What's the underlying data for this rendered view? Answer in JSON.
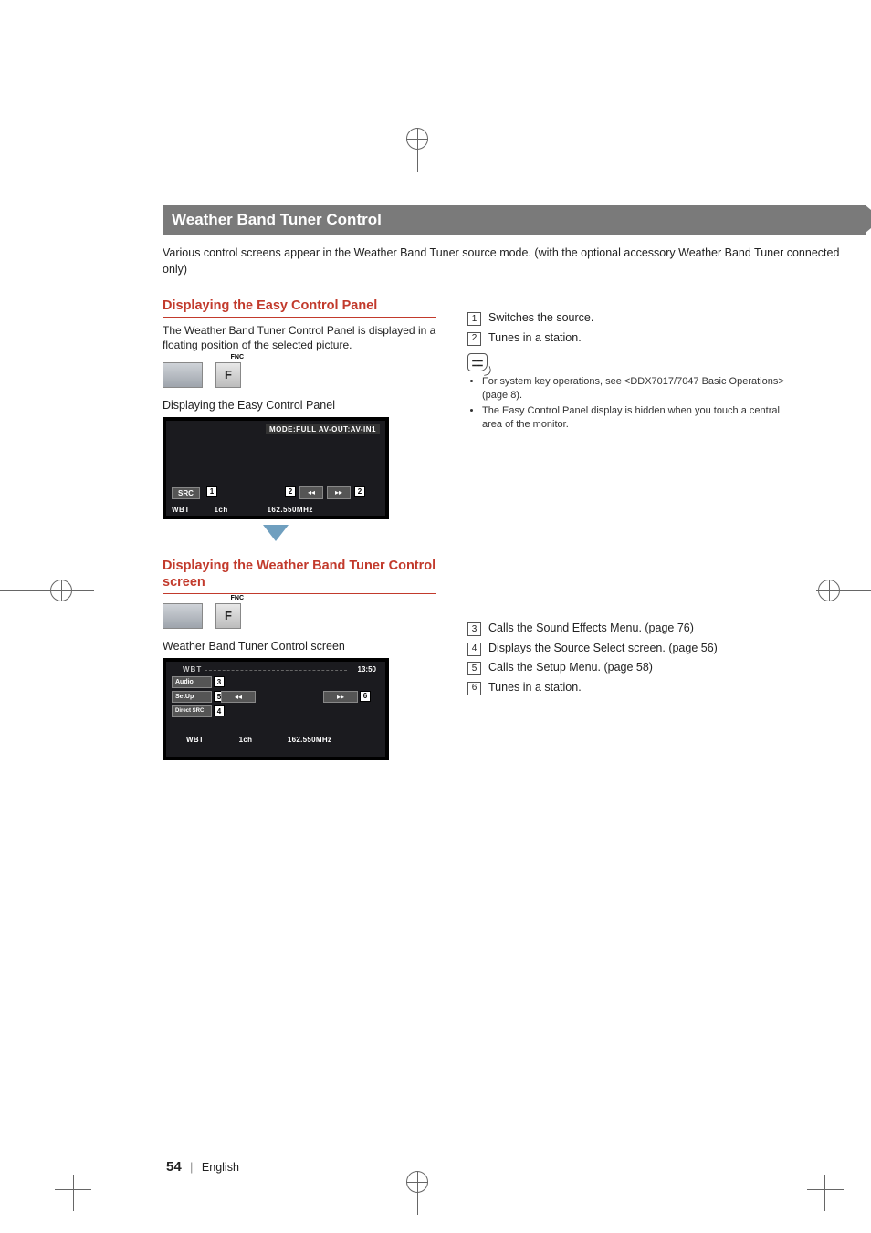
{
  "title": "Weather Band Tuner Control",
  "intro": "Various control screens appear in the Weather Band Tuner source mode. (with the optional accessory Weather Band Tuner connected only)",
  "section1": {
    "heading": "Displaying the Easy Control Panel",
    "desc": "The Weather Band Tuner Control Panel is displayed in a floating position of the selected picture.",
    "caption": "Displaying the Easy Control Panel"
  },
  "screenshot1": {
    "mode": "MODE:FULL  AV-OUT:AV-IN1",
    "src": "SRC",
    "band": "WBT",
    "channel": "1ch",
    "freq": "162.550MHz"
  },
  "right1": {
    "items": [
      {
        "n": "1",
        "text": "Switches the source."
      },
      {
        "n": "2",
        "text": "Tunes in a station."
      }
    ],
    "notes": [
      "For system key operations, see <DDX7017/7047 Basic Operations> (page 8).",
      "The Easy Control Panel display is hidden when you touch a central area of the monitor."
    ]
  },
  "section2": {
    "heading": "Displaying the Weather Band Tuner Control screen",
    "caption": "Weather Band Tuner Control screen"
  },
  "screenshot2": {
    "wbt_top": "WBT",
    "time": "13:50",
    "audio": "Audio",
    "setup": "SetUp",
    "direct": "Direct SRC",
    "band": "WBT",
    "channel": "1ch",
    "freq": "162.550MHz"
  },
  "right2": {
    "items": [
      {
        "n": "3",
        "text": "Calls the Sound Effects Menu. (page 76)"
      },
      {
        "n": "4",
        "text": "Displays the Source Select screen. (page 56)"
      },
      {
        "n": "5",
        "text": "Calls the Setup Menu. (page 58)"
      },
      {
        "n": "6",
        "text": "Tunes in a station."
      }
    ]
  },
  "footer": {
    "page": "54",
    "lang": "English"
  },
  "fnc": "FNC",
  "f": "F"
}
